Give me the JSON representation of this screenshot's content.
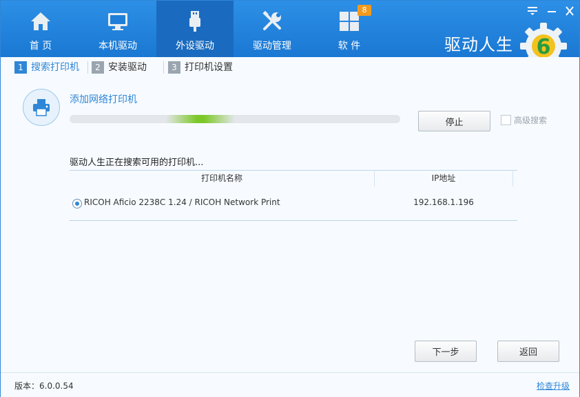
{
  "window": {
    "brand": "驱动人生",
    "controls": [
      "menu-icon",
      "minimize-icon",
      "close-icon"
    ]
  },
  "nav": [
    {
      "label": "首 页",
      "icon": "home-icon"
    },
    {
      "label": "本机驱动",
      "icon": "monitor-icon"
    },
    {
      "label": "外设驱动",
      "icon": "usb-icon",
      "active": true
    },
    {
      "label": "驱动管理",
      "icon": "tools-icon"
    },
    {
      "label": "软 件",
      "icon": "apps-icon",
      "badge": "8"
    }
  ],
  "steps": [
    {
      "num": "1",
      "label": "搜索打印机",
      "active": true
    },
    {
      "num": "2",
      "label": "安装驱动"
    },
    {
      "num": "3",
      "label": "打印机设置"
    }
  ],
  "search": {
    "add_network_label": "添加网络打印机",
    "stop_button": "停止",
    "advanced_label": "高级搜索",
    "status_text": "驱动人生正在搜索可用的打印机..."
  },
  "table": {
    "headers": [
      "打印机名称",
      "IP地址"
    ],
    "rows": [
      {
        "name": "RICOH Aficio 2238C 1.24 / RICOH Network Print",
        "ip": "192.168.1.196",
        "selected": true
      }
    ]
  },
  "actions": {
    "next_button": "下一步",
    "back_button": "返回"
  },
  "footer": {
    "version": "版本：6.0.0.54",
    "update_link": "检查升级"
  },
  "colors": {
    "accent": "#2f86d6",
    "topbar": "#1a78d3",
    "active_tab": "#1a6bbf",
    "badge": "#f39a1e",
    "progress": "#7cc828"
  }
}
